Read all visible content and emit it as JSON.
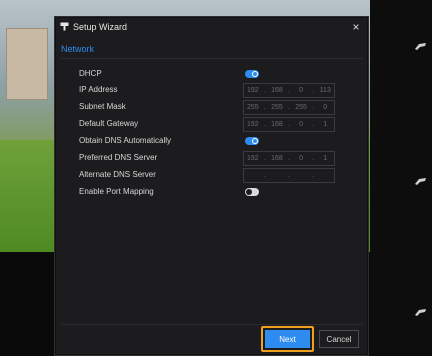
{
  "dialog": {
    "title": "Setup Wizard",
    "close_symbol": "×",
    "icon": "camera-icon"
  },
  "tabs": [
    {
      "label": "Network",
      "active": true
    }
  ],
  "fields": {
    "dhcp": {
      "label": "DHCP",
      "enabled": true
    },
    "ip_address": {
      "label": "IP Address",
      "octets": [
        "192",
        "168",
        "0",
        "113"
      ]
    },
    "subnet_mask": {
      "label": "Subnet Mask",
      "octets": [
        "255",
        "255",
        "255",
        "0"
      ]
    },
    "default_gateway": {
      "label": "Default Gateway",
      "octets": [
        "192",
        "168",
        "0",
        "1"
      ]
    },
    "obtain_dns": {
      "label": "Obtain DNS Automatically",
      "enabled": true
    },
    "preferred_dns": {
      "label": "Preferred DNS Server",
      "octets": [
        "192",
        "168",
        "0",
        "1"
      ]
    },
    "alternate_dns": {
      "label": "Alternate DNS Server",
      "octets": [
        "",
        "",
        "",
        ""
      ]
    },
    "port_mapping": {
      "label": "Enable Port Mapping",
      "enabled": false
    }
  },
  "octet_separator": ".",
  "buttons": {
    "next": "Next",
    "cancel": "Cancel"
  },
  "colors": {
    "accent": "#2e8cf0",
    "highlight": "#f0a020",
    "dialog_bg": "#1c1c1e"
  }
}
